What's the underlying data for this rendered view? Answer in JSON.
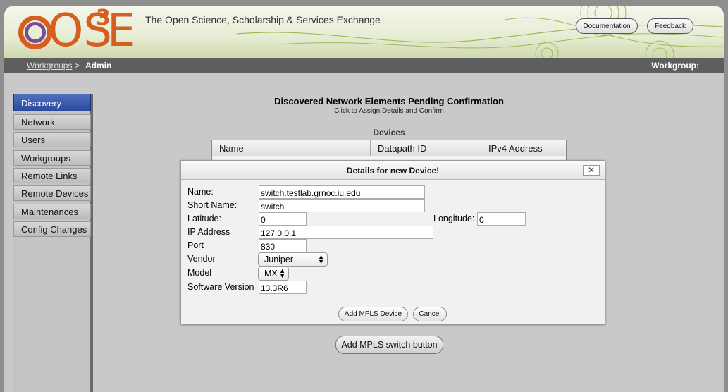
{
  "header": {
    "logo": {
      "mark": "OS",
      "superscript": "3",
      "letter": "E"
    },
    "tagline": "The Open Science, Scholarship & Services Exchange",
    "buttons": {
      "documentation": "Documentation",
      "feedback": "Feedback"
    }
  },
  "breadcrumb": {
    "link": "Workgroups",
    "separator": ">",
    "current": "Admin",
    "workgroup_label": "Workgroup:"
  },
  "sidebar": {
    "items": [
      {
        "label": "Discovery",
        "active": true
      },
      {
        "label": "Network"
      },
      {
        "label": "Users"
      },
      {
        "label": "Workgroups"
      },
      {
        "label": "Remote Links"
      },
      {
        "label": "Remote Devices"
      },
      {
        "label": "Maintenances"
      },
      {
        "label": "Config Changes"
      }
    ]
  },
  "main": {
    "title": "Discovered Network Elements Pending Confirmation",
    "subtitle": "Click to Assign Details and Confirm",
    "devices_label": "Devices",
    "columns": [
      "Name",
      "Datapath ID",
      "IPv4 Address"
    ],
    "add_switch_button": "Add MPLS switch button"
  },
  "dialog": {
    "title": "Details for new Device!",
    "close": "✕",
    "fields": {
      "name": {
        "label": "Name:",
        "value": "switch.testlab.grnoc.iu.edu"
      },
      "short_name": {
        "label": "Short Name:",
        "value": "switch"
      },
      "latitude": {
        "label": "Latitude:",
        "value": "0"
      },
      "longitude": {
        "label": "Longitude:",
        "value": "0"
      },
      "ip_address": {
        "label": "IP Address",
        "value": "127.0.0.1"
      },
      "port": {
        "label": "Port",
        "value": "830"
      },
      "vendor": {
        "label": "Vendor",
        "value": "Juniper"
      },
      "model": {
        "label": "Model",
        "value": "MX"
      },
      "software_version": {
        "label": "Software Version",
        "value": "13.3R6"
      }
    },
    "buttons": {
      "add": "Add MPLS Device",
      "cancel": "Cancel"
    }
  },
  "icons": {
    "close": "close-icon",
    "select_arrows": "updown-arrows-icon"
  },
  "colors": {
    "brand_orange": "#d45f1e",
    "brand_purple": "#7b4a9b",
    "nav_active": "#2b4a9c",
    "header_green": "#cfd9b0"
  }
}
